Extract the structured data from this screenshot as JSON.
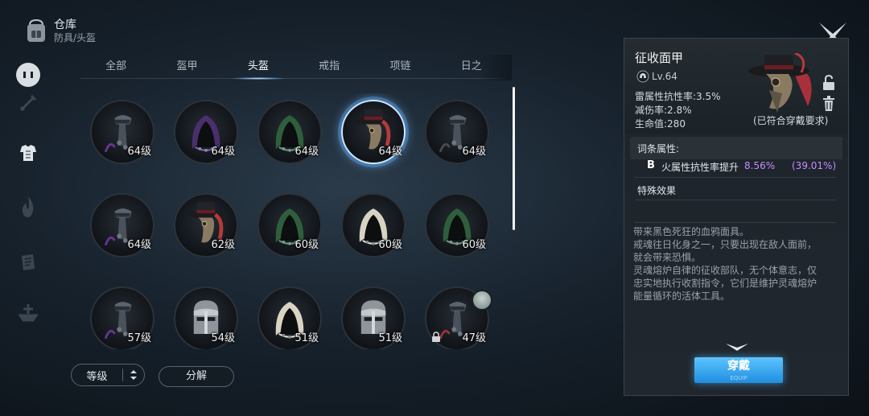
{
  "header": {
    "title": "仓库",
    "subtitle": "防具/头盔"
  },
  "tabs": [
    {
      "label": "全部",
      "active": false
    },
    {
      "label": "盔甲",
      "active": false
    },
    {
      "label": "头盔",
      "active": true
    },
    {
      "label": "戒指",
      "active": false
    },
    {
      "label": "项链",
      "active": false
    },
    {
      "label": "日之",
      "active": false
    }
  ],
  "side_icons": [
    "chat-bubble-icon",
    "sword-icon",
    "armor-icon",
    "flame-icon",
    "scroll-icon",
    "ship-icon"
  ],
  "items": [
    {
      "level": "64级",
      "icon": "steel-mask-helmet-icon",
      "accent": "#7a3bb5",
      "selected": false
    },
    {
      "level": "64级",
      "icon": "purple-hood-icon",
      "accent": "#8b5cc9",
      "selected": false
    },
    {
      "level": "64级",
      "icon": "green-hood-icon",
      "accent": "#58a86a",
      "selected": false
    },
    {
      "level": "64级",
      "icon": "plague-mask-hat-icon",
      "accent": "#b63a3a",
      "selected": true
    },
    {
      "level": "64级",
      "icon": "steel-mask-helmet-icon",
      "accent": "#555",
      "selected": false
    },
    {
      "level": "64级",
      "icon": "steel-mask-helmet-icon",
      "accent": "#7a3bb5",
      "selected": false
    },
    {
      "level": "62级",
      "icon": "plague-mask-hat-icon",
      "accent": "#b63a3a",
      "selected": false
    },
    {
      "level": "60级",
      "icon": "green-hood-icon",
      "accent": "#58a86a",
      "selected": false
    },
    {
      "level": "60级",
      "icon": "white-hood-icon",
      "accent": "#e8e2d2",
      "selected": false
    },
    {
      "level": "60级",
      "icon": "green-hood-icon",
      "accent": "#58a86a",
      "selected": false
    },
    {
      "level": "57级",
      "icon": "steel-mask-helmet-icon",
      "accent": "#7a3bb5",
      "selected": false
    },
    {
      "level": "54级",
      "icon": "knight-helm-icon",
      "accent": "#9aa0a6",
      "selected": false
    },
    {
      "level": "51级",
      "icon": "white-hood-icon",
      "accent": "#e8e2d2",
      "selected": false
    },
    {
      "level": "51级",
      "icon": "knight-helm-icon",
      "accent": "#9aa0a6",
      "selected": false
    },
    {
      "level": "47级",
      "icon": "steel-mask-helmet-icon",
      "accent": "#b63a3a",
      "selected": false,
      "locked": true,
      "equipped_by_avatar": true
    }
  ],
  "controls": {
    "sort_label": "等级",
    "decompose_label": "分解"
  },
  "detail": {
    "name": "征收面甲",
    "level": "Lv.64",
    "stats": [
      "雷属性抗性率:3.5%",
      "减伤率:2.8%",
      "生命值:280"
    ],
    "requirement_note": "(已符合穿戴要求)",
    "affix_title": "词条属性:",
    "affix": {
      "grade": "B",
      "text": "火属性抗性率提升",
      "value": "8.56%",
      "percent": "(39.01%)"
    },
    "special_title": "特殊效果",
    "description": [
      "带来黑色死狂的血鸦面具。",
      "戒魂往日化身之一，只要出现在敌人面前，",
      "就会带来恐惧。",
      "灵魂熔炉自律的征收部队，无个体意志，仅",
      "忠实地执行收割指令，它们是维护灵魂熔炉",
      "能量循环的活体工具。"
    ],
    "equip_label": "穿戴",
    "equip_sublabel": "EQUIP"
  },
  "colors": {
    "accent_blue": "#2f9cf0",
    "affix_purple": "#c78cff"
  }
}
